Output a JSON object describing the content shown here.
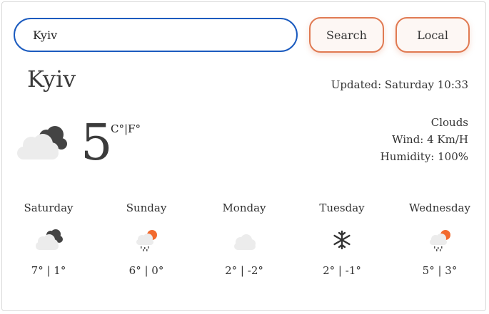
{
  "search": {
    "value": "Kyiv"
  },
  "buttons": {
    "search_label": "Search",
    "local_label": "Local"
  },
  "current": {
    "city": "Kyiv",
    "updated": "Updated: Saturday 10:33",
    "temperature": "5",
    "units": "C°|F°",
    "condition": "Clouds",
    "wind": "Wind: 4 Km/H",
    "humidity": "Humidity: 100%",
    "icon": "cloudy-icon"
  },
  "forecast": [
    {
      "day": "Saturday",
      "temp": "7° | 1°",
      "icon": "cloudy-icon"
    },
    {
      "day": "Sunday",
      "temp": "6° | 0°",
      "icon": "sun-rain-icon"
    },
    {
      "day": "Monday",
      "temp": "2° | -2°",
      "icon": "cloud-icon"
    },
    {
      "day": "Tuesday",
      "temp": "2° | -1°",
      "icon": "snowflake-icon"
    },
    {
      "day": "Wednesday",
      "temp": "5° | 3°",
      "icon": "sun-rain-icon"
    }
  ],
  "colors": {
    "accent": "#e07a52",
    "input_border": "#1b5bbf",
    "sun": "#f26a2e"
  }
}
